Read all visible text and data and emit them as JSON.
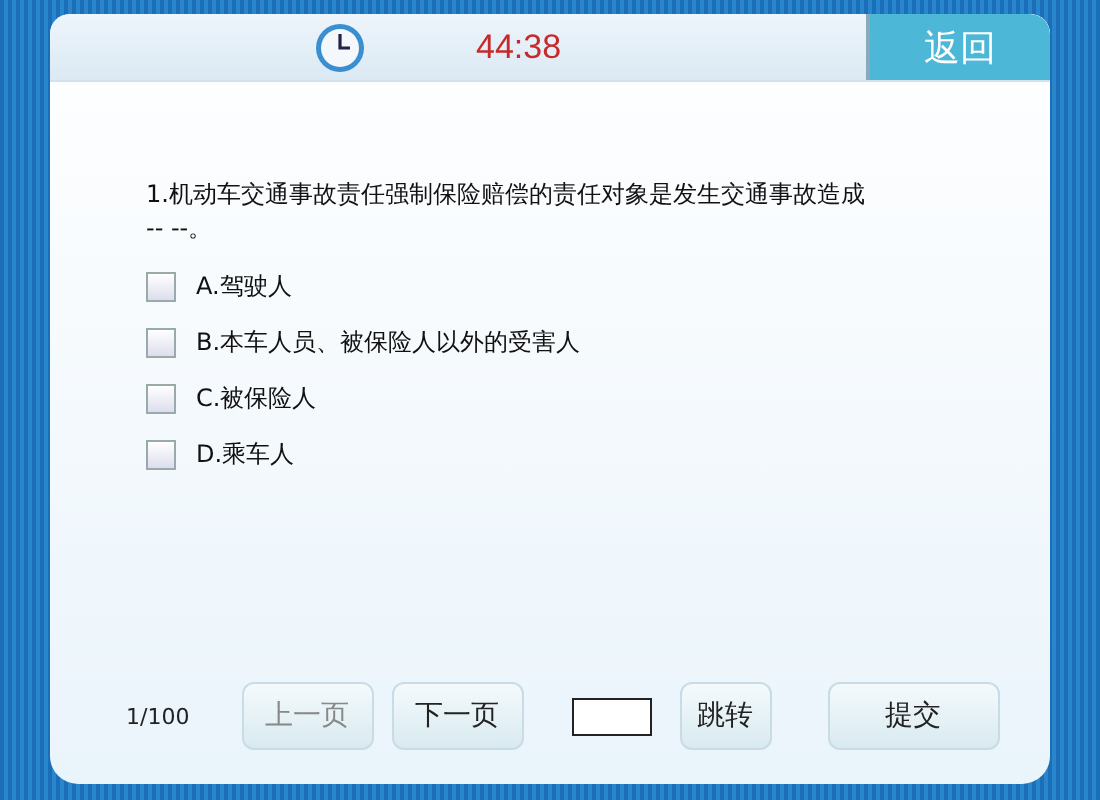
{
  "header": {
    "timer": "44:38",
    "back_button": "返回"
  },
  "question": {
    "text": "1.机动车交通事故责任强制保险赔偿的责任对象是发生交通事故造成\n-- --。",
    "options": [
      {
        "label": "A.驾驶人",
        "checked": false
      },
      {
        "label": "B.本车人员、被保险人以外的受害人",
        "checked": false
      },
      {
        "label": "C.被保险人",
        "checked": false
      },
      {
        "label": "D.乘车人",
        "checked": false
      }
    ]
  },
  "footer": {
    "page_counter": "1/100",
    "buttons": [
      {
        "label": "上一页",
        "disabled": true
      },
      {
        "label": "下一页",
        "disabled": false
      }
    ],
    "jump_button": "跳转",
    "submit_button": "提交"
  }
}
